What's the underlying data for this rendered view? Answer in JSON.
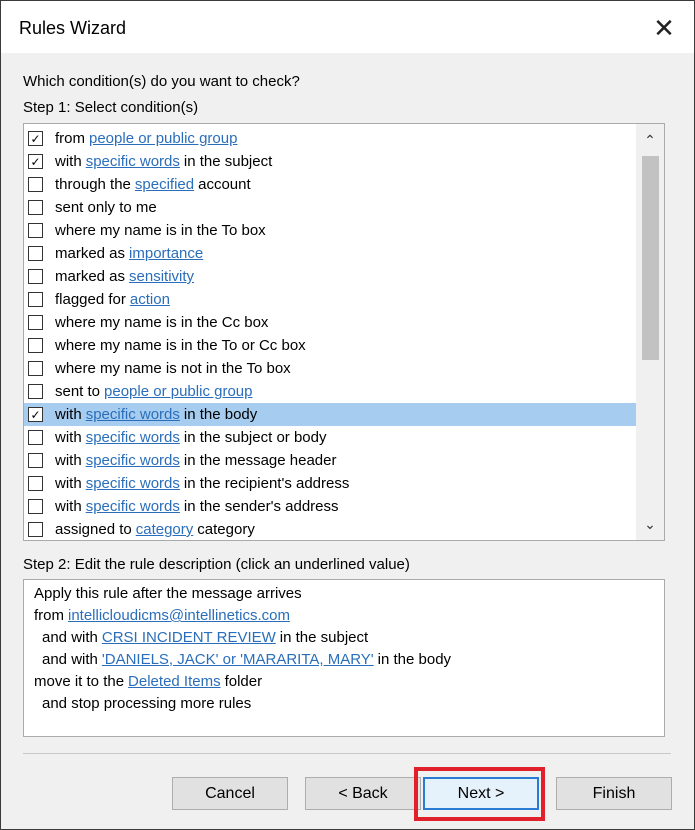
{
  "window": {
    "title": "Rules Wizard",
    "close_glyph": "✕"
  },
  "prompt": "Which condition(s) do you want to check?",
  "step1": "Step 1: Select condition(s)",
  "conditions": [
    {
      "checked": true,
      "parts": [
        {
          "t": "from"
        },
        {
          "l": "people or public group"
        }
      ]
    },
    {
      "checked": true,
      "parts": [
        {
          "t": "with"
        },
        {
          "l": "specific words"
        },
        {
          "t": "in the subject"
        }
      ]
    },
    {
      "checked": false,
      "parts": [
        {
          "t": "through the"
        },
        {
          "l": "specified"
        },
        {
          "t": "account"
        }
      ]
    },
    {
      "checked": false,
      "parts": [
        {
          "t": "sent only to me"
        }
      ]
    },
    {
      "checked": false,
      "parts": [
        {
          "t": "where my name is in the To box"
        }
      ]
    },
    {
      "checked": false,
      "parts": [
        {
          "t": "marked as"
        },
        {
          "l": "importance"
        }
      ]
    },
    {
      "checked": false,
      "parts": [
        {
          "t": "marked as"
        },
        {
          "l": "sensitivity"
        }
      ]
    },
    {
      "checked": false,
      "parts": [
        {
          "t": "flagged for"
        },
        {
          "l": "action"
        }
      ]
    },
    {
      "checked": false,
      "parts": [
        {
          "t": "where my name is in the Cc box"
        }
      ]
    },
    {
      "checked": false,
      "parts": [
        {
          "t": "where my name is in the To or Cc box"
        }
      ]
    },
    {
      "checked": false,
      "parts": [
        {
          "t": "where my name is not in the To box"
        }
      ]
    },
    {
      "checked": false,
      "parts": [
        {
          "t": "sent to"
        },
        {
          "l": "people or public group"
        }
      ]
    },
    {
      "checked": true,
      "selected": true,
      "parts": [
        {
          "t": "with"
        },
        {
          "l": "specific words"
        },
        {
          "t": "in the body"
        }
      ]
    },
    {
      "checked": false,
      "parts": [
        {
          "t": "with"
        },
        {
          "l": "specific words"
        },
        {
          "t": "in the subject or body"
        }
      ]
    },
    {
      "checked": false,
      "parts": [
        {
          "t": "with"
        },
        {
          "l": "specific words"
        },
        {
          "t": "in the message header"
        }
      ]
    },
    {
      "checked": false,
      "parts": [
        {
          "t": "with"
        },
        {
          "l": "specific words"
        },
        {
          "t": "in the recipient's address"
        }
      ]
    },
    {
      "checked": false,
      "parts": [
        {
          "t": "with"
        },
        {
          "l": "specific words"
        },
        {
          "t": "in the sender's address"
        }
      ]
    },
    {
      "checked": false,
      "parts": [
        {
          "t": "assigned to"
        },
        {
          "l": "category"
        },
        {
          "t": "category"
        }
      ]
    }
  ],
  "scroll": {
    "up": "⌃",
    "down": "⌄"
  },
  "step2": "Step 2: Edit the rule description (click an underlined value)",
  "description": [
    {
      "indent": 0,
      "parts": [
        {
          "t": "Apply this rule after the message arrives"
        }
      ]
    },
    {
      "indent": 0,
      "parts": [
        {
          "t": "from"
        },
        {
          "l": "intellicloudicms@intellinetics.com"
        }
      ]
    },
    {
      "indent": 8,
      "parts": [
        {
          "t": "and with"
        },
        {
          "l": "CRSI INCIDENT REVIEW"
        },
        {
          "t": "in the subject"
        }
      ]
    },
    {
      "indent": 8,
      "parts": [
        {
          "t": "and with"
        },
        {
          "l": "'DANIELS, JACK' or 'MARARITA, MARY'"
        },
        {
          "t": "in the body"
        }
      ]
    },
    {
      "indent": 0,
      "parts": [
        {
          "t": "move it to the"
        },
        {
          "l": "Deleted Items"
        },
        {
          "t": "folder"
        }
      ]
    },
    {
      "indent": 8,
      "parts": [
        {
          "t": "and stop processing more rules"
        }
      ]
    }
  ],
  "buttons": {
    "cancel": "Cancel",
    "back": "< Back",
    "next": "Next >",
    "finish": "Finish"
  },
  "colors": {
    "link": "#2a6ebb",
    "highlight": "#e0202a",
    "selection": "#a6cdf0"
  }
}
